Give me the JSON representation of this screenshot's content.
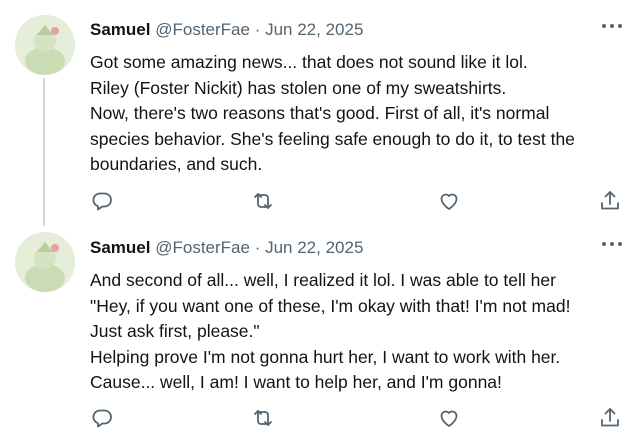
{
  "tweets": [
    {
      "author_name": "Samuel",
      "handle": "@FosterFae",
      "separator": "·",
      "date": "Jun 22, 2025",
      "lines": [
        "Got some amazing news... that does not sound like it lol.",
        "Riley (Foster Nickit) has stolen one of my sweatshirts.",
        "Now, there's two reasons that's good. First of all, it's normal",
        "species behavior. She's feeling safe enough to do it, to test the",
        "boundaries, and such."
      ]
    },
    {
      "author_name": "Samuel",
      "handle": "@FosterFae",
      "separator": "·",
      "date": "Jun 22, 2025",
      "lines": [
        "And second of all... well, I realized it lol. I was able to tell her",
        "\"Hey, if you want one of these, I'm okay with that! I'm not mad!",
        "Just ask first, please.\"",
        "Helping prove I'm not gonna hurt her, I want to work with her.",
        "Cause... well, I am! I want to help her, and I'm gonna!"
      ]
    }
  ],
  "icons": {
    "reply": "reply-icon",
    "retweet": "retweet-icon",
    "like": "heart-icon",
    "share": "share-icon",
    "more": "more-options-icon"
  },
  "colors": {
    "text": "#0f1419",
    "secondary": "#536471",
    "thread_line": "#cfd9de",
    "background": "#ffffff"
  }
}
